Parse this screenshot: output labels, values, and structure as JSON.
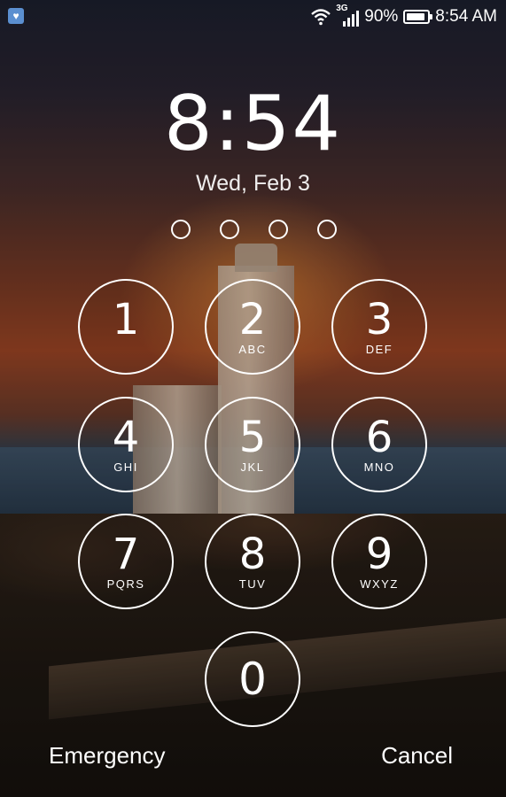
{
  "status_bar": {
    "wifi_icon": "wifi-icon",
    "network_type": "3G",
    "battery_percent": "90%",
    "battery_level": 0.9,
    "time": "8:54 AM"
  },
  "lockscreen": {
    "clock": "8:54",
    "date": "Wed, Feb 3",
    "pin_entered_count": 0,
    "pin_length": 4
  },
  "keypad": {
    "keys": [
      {
        "digit": "1",
        "letters": ""
      },
      {
        "digit": "2",
        "letters": "ABC"
      },
      {
        "digit": "3",
        "letters": "DEF"
      },
      {
        "digit": "4",
        "letters": "GHI"
      },
      {
        "digit": "5",
        "letters": "JKL"
      },
      {
        "digit": "6",
        "letters": "MNO"
      },
      {
        "digit": "7",
        "letters": "PQRS"
      },
      {
        "digit": "8",
        "letters": "TUV"
      },
      {
        "digit": "9",
        "letters": "WXYZ"
      },
      {
        "digit": "0",
        "letters": ""
      }
    ]
  },
  "actions": {
    "emergency": "Emergency",
    "cancel": "Cancel"
  }
}
